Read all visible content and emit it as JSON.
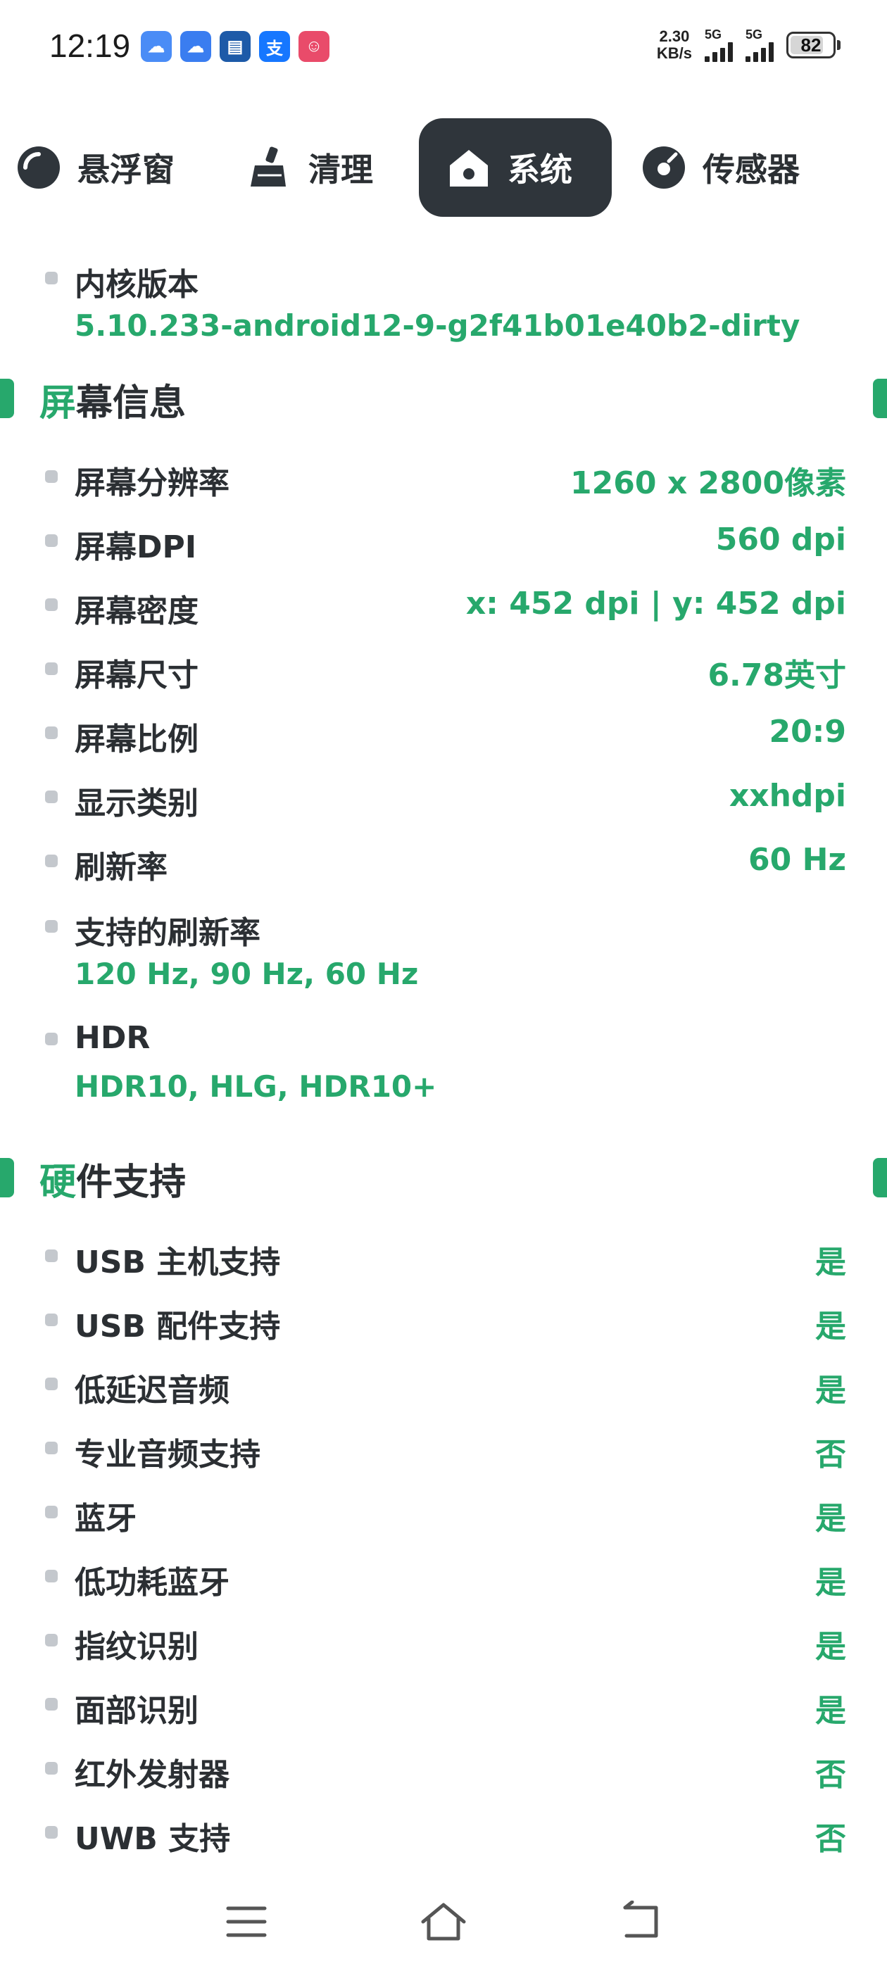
{
  "status_bar": {
    "time": "12:19",
    "apps": [
      {
        "icon": "baiduyun-icon",
        "glyph": "☁",
        "color": "#4a8cf6"
      },
      {
        "icon": "baiduyun2-icon",
        "glyph": "☁",
        "color": "#3a7df0"
      },
      {
        "icon": "calculator-icon",
        "glyph": "▤",
        "color": "#1d5aa8"
      },
      {
        "icon": "alipay-icon",
        "glyph": "支",
        "color": "#1677ff"
      },
      {
        "icon": "clown-app-icon",
        "glyph": "☺",
        "color": "#e94b6a"
      }
    ],
    "speed_value": "2.30",
    "speed_unit": "KB/s",
    "signal1_label": "5G",
    "signal2_label": "5G",
    "battery": "82",
    "battery_fraction": 0.82
  },
  "tabs": [
    {
      "label": "悬浮窗",
      "icon": "floating-window-icon",
      "active": false
    },
    {
      "label": "清理",
      "icon": "broom-icon",
      "active": false
    },
    {
      "label": "系统",
      "icon": "home-icon",
      "active": true
    },
    {
      "label": "传感器",
      "icon": "sensor-icon",
      "active": false
    }
  ],
  "kernel": {
    "label": "内核版本",
    "value": "5.10.233-android12-9-g2f41b01e40b2-dirty"
  },
  "screen_section": {
    "title_first": "屏",
    "title_rest": "幕信息",
    "rows": [
      {
        "label": "屏幕分辨率",
        "value": "1260 x 2800像素"
      },
      {
        "label": "屏幕DPI",
        "value": "560 dpi"
      },
      {
        "label": "屏幕密度",
        "value": "x: 452 dpi | y: 452 dpi"
      },
      {
        "label": "屏幕尺寸",
        "value": "6.78英寸"
      },
      {
        "label": "屏幕比例",
        "value": "20:9"
      },
      {
        "label": "显示类别",
        "value": "xxhdpi"
      },
      {
        "label": "刷新率",
        "value": "60 Hz"
      }
    ],
    "refresh_supported": {
      "label": "支持的刷新率",
      "value": "120 Hz, 90 Hz, 60 Hz"
    },
    "hdr": {
      "label": "HDR",
      "value": "HDR10, HLG, HDR10+"
    }
  },
  "hardware_section": {
    "title_first": "硬",
    "title_rest": "件支持",
    "rows": [
      {
        "label": "USB 主机支持",
        "value": "是"
      },
      {
        "label": "USB 配件支持",
        "value": "是"
      },
      {
        "label": "低延迟音频",
        "value": "是"
      },
      {
        "label": "专业音频支持",
        "value": "否"
      },
      {
        "label": "蓝牙",
        "value": "是"
      },
      {
        "label": "低功耗蓝牙",
        "value": "是"
      },
      {
        "label": "指纹识别",
        "value": "是"
      },
      {
        "label": "面部识别",
        "value": "是"
      },
      {
        "label": "红外发射器",
        "value": "否"
      },
      {
        "label": "UWB 支持",
        "value": "否"
      }
    ]
  },
  "navbar": {
    "menu": "menu-icon",
    "home": "home-nav-icon",
    "back": "back-icon"
  },
  "colors": {
    "accent": "#27a86c",
    "active_tab_bg": "#2f353b",
    "text": "#2b2f33"
  }
}
